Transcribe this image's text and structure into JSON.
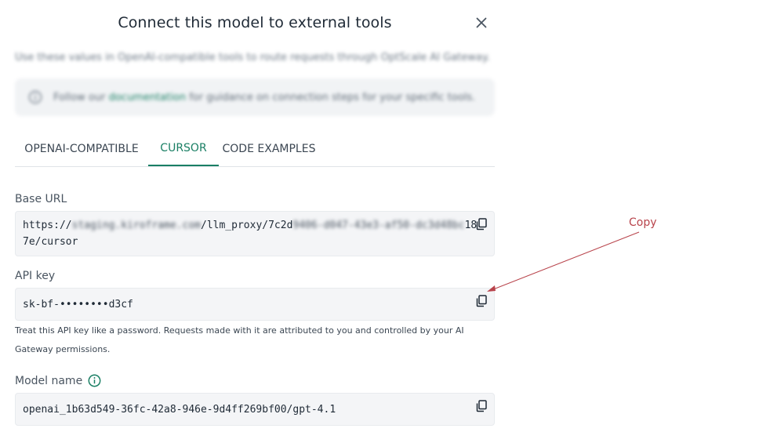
{
  "dialog": {
    "title": "Connect this model to external tools",
    "subtitle": "Use these values in OpenAI-compatible tools to route requests through OptScale AI Gateway.",
    "info_prefix": "Follow our",
    "info_link": "documentation",
    "info_suffix": "for guidance on connection steps for your specific tools."
  },
  "tabs": [
    {
      "label": "OPENAI-COMPATIBLE",
      "active": false
    },
    {
      "label": "CURSOR",
      "active": true
    },
    {
      "label": "CODE EXAMPLES",
      "active": false
    }
  ],
  "base_url": {
    "label": "Base URL",
    "line1_start": "https://",
    "line1_blur1": "staging.kiroframe.com",
    "line1_mid": "/llm_proxy/7c2d",
    "line1_blur2": "9406-d047-43e3-af50-dc3d48bc",
    "line1_end": "18",
    "line2": "7e/cursor"
  },
  "api_key": {
    "label": "API key",
    "value": "sk-bf-••••••••d3cf",
    "help": "Treat this API key like a password. Requests made with it are attributed to you and controlled by your AI Gateway permissions."
  },
  "model_name": {
    "label": "Model name",
    "value": "openai_1b63d549-36fc-42a8-946e-9d4ff269bf00/gpt-4.1"
  },
  "annotation": {
    "label": "Copy"
  },
  "colors": {
    "accent": "#1a7f64",
    "annotation": "#b8434b",
    "field_bg": "#f4f5f7"
  }
}
